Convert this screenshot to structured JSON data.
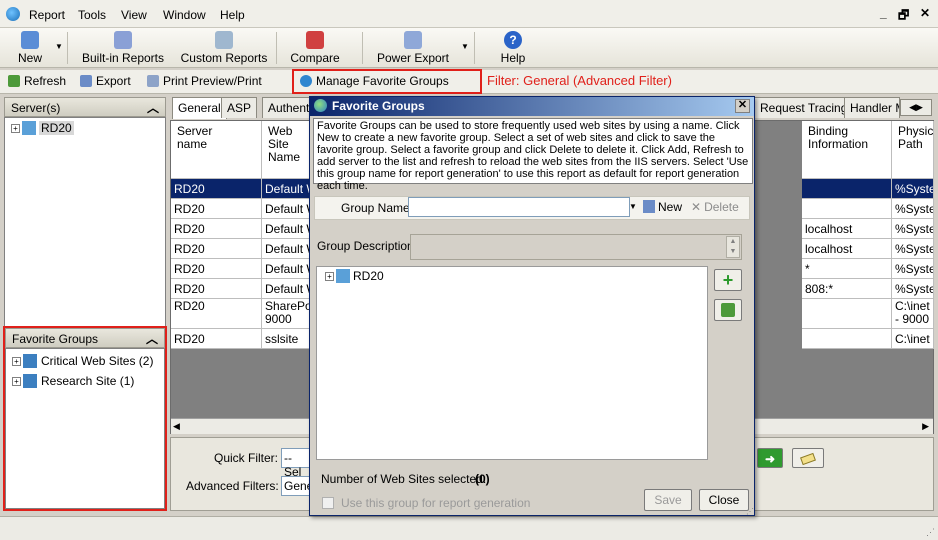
{
  "menu": {
    "items": [
      "Report",
      "Tools",
      "View",
      "Window",
      "Help"
    ],
    "window_buttons": [
      "_",
      "🗗",
      "✕"
    ]
  },
  "toolbar": {
    "new": "New",
    "builtin": "Built-in Reports",
    "custom": "Custom Reports",
    "compare": "Compare",
    "power_export": "Power Export",
    "help": "Help"
  },
  "toolbar2": {
    "refresh": "Refresh",
    "export": "Export",
    "print": "Print Preview/Print",
    "manage": "Manage Favorite Groups",
    "filter_status": "Filter: General (Advanced Filter)"
  },
  "servers": {
    "header": "Server(s)",
    "items": [
      "RD20"
    ]
  },
  "favorites": {
    "header": "Favorite Groups",
    "items": [
      "Critical Web Sites (2)",
      "Research Site (1)"
    ]
  },
  "tabs": {
    "items": [
      "General",
      "ASP",
      "Authenti",
      "Request Tracing",
      "Handler M"
    ]
  },
  "grid": {
    "headers": [
      "Server name",
      "Web Site Name",
      "Binding Information",
      "Physical Path"
    ],
    "header_cells": {
      "server": "Server\nname",
      "site": "Web Site\nName",
      "binding": "Binding\nInformation",
      "path": "Physic\nPath"
    },
    "rows": [
      {
        "server": "RD20",
        "site": "Default W",
        "binding": "",
        "path": "%Syste"
      },
      {
        "server": "RD20",
        "site": "Default W",
        "binding": "",
        "path": "%Syste"
      },
      {
        "server": "RD20",
        "site": "Default W",
        "binding": "localhost",
        "path": "%Syste"
      },
      {
        "server": "RD20",
        "site": "Default W",
        "binding": "localhost",
        "path": "%Syste"
      },
      {
        "server": "RD20",
        "site": "Default W",
        "binding": "*",
        "path": "%Syste"
      },
      {
        "server": "RD20",
        "site": "Default W",
        "binding": "808:*",
        "path": "%Syste"
      },
      {
        "server": "RD20",
        "site": "SharePoi 9000",
        "binding": "",
        "path": "C:\\inet - 9000"
      },
      {
        "server": "RD20",
        "site": "sslsite",
        "binding": "",
        "path": "C:\\inet"
      }
    ]
  },
  "filters": {
    "quick_label": "Quick Filter:",
    "quick_value": "--Sel",
    "advanced_label": "Advanced Filters:",
    "advanced_value": "Gene"
  },
  "dialog": {
    "title": "Favorite Groups",
    "description": "Favorite Groups can be used to store frequently used web sites by using a name. Click New to create a new favorite group. Select a set of web sites and click to save the favorite group. Select a favorite group and click Delete to delete it. Click Add, Refresh to add server to the list and refresh to reload the web sites from the IIS servers. Select 'Use this group name for report generation' to use this report as default for report generation each time.",
    "group_name_label": "Group Name:",
    "group_name_value": "",
    "new_label": "New",
    "delete_label": "Delete",
    "group_desc_label": "Group Description:",
    "tree_items": [
      "RD20"
    ],
    "count_label": "Number of Web Sites selected:",
    "count_value": "(0)",
    "checkbox_label": "Use this group for report generation",
    "save_label": "Save",
    "close_label": "Close"
  },
  "colors": {
    "highlight": "#e0201a",
    "selection": "#0a246a",
    "filter_text": "#e0201a"
  }
}
